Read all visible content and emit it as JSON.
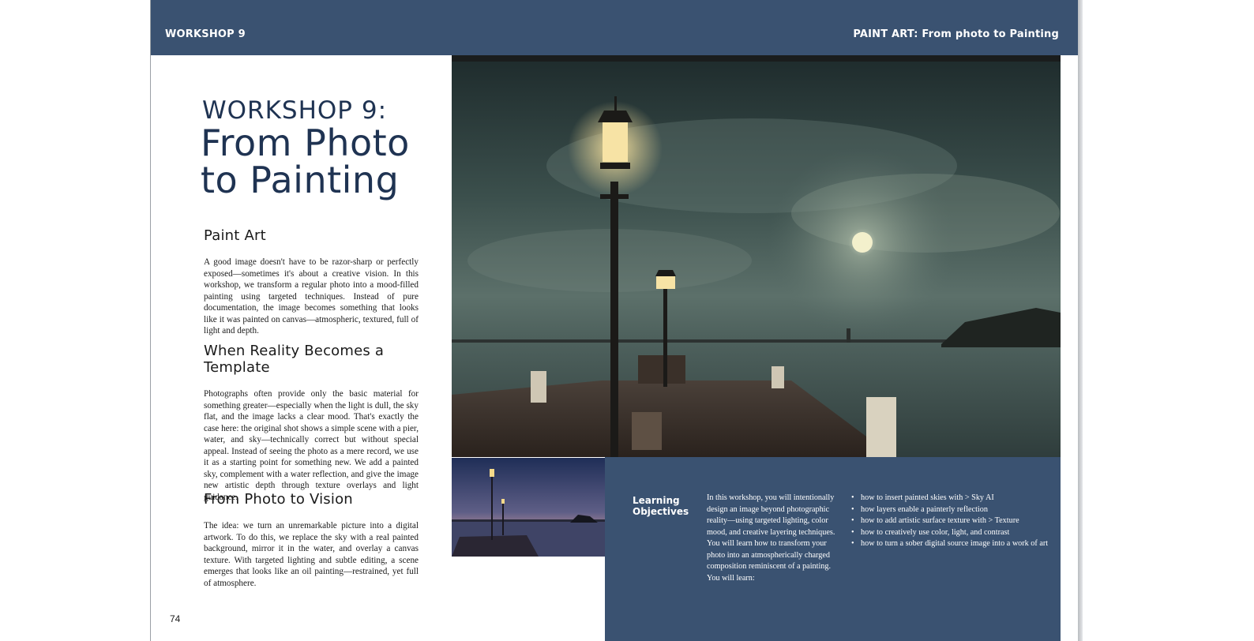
{
  "header": {
    "left_label": "WORKSHOP 9",
    "right_label": "PAINT ART: From photo to Painting"
  },
  "title": {
    "line1": "WORKSHOP 9:",
    "line2": "From Photo",
    "line3": "to Painting"
  },
  "sections": [
    {
      "heading": "Paint Art",
      "body": "A good image doesn't have to be razor-sharp or perfectly exposed—sometimes it's about a creative vision. In this workshop, we transform a regular photo into a mood-filled painting using targeted techniques. Instead of pure documentation, the image becomes something that looks like it was painted on canvas—atmospheric, textured, full of light and depth."
    },
    {
      "heading": "When Reality Becomes a Template",
      "body": "Photographs often provide only the basic material for something greater—especially when the light is dull, the sky flat, and the image lacks a clear mood. That's exactly the case here: the original shot shows a simple scene with a pier, water, and sky—technically correct but without special appeal. Instead of seeing the photo as a mere record, we use it as a starting point for something new. We add a painted sky, complement with a water reflection, and give the image new artistic depth through texture overlays and light guidance."
    },
    {
      "heading": "From Photo to Vision",
      "body": "The idea: we turn an unremarkable picture into a digital artwork. To do this, we replace the sky with a real painted background, mirror it in the water, and overlay a canvas texture. With targeted lighting and subtle editing, a scene emerges that looks like an oil painting—restrained, yet full of atmosphere."
    }
  ],
  "page_number": "74",
  "objectives": {
    "title": "Learning Objectives",
    "intro": "In this workshop, you will intentionally design an image beyond photographic reality—using targeted lighting, color mood, and creative layering techniques. You will learn how to transform your photo into an atmospherically charged composition reminiscent of a painting. You will learn:",
    "items": [
      "how to insert painted skies with > Sky AI",
      "how layers enable a painterly reflection",
      "how to add artistic surface texture with > Texture",
      "how to creatively use color, light, and contrast",
      "how to turn a sober digital source image into a work of art"
    ]
  },
  "images": {
    "hero": "painted night harbor scene with lamp posts, pier and moonlit clouds",
    "thumbnail": "original dusk photo of pier with lamp posts"
  },
  "colors": {
    "header_bg": "#3a5271",
    "title_text": "#1f3352"
  }
}
